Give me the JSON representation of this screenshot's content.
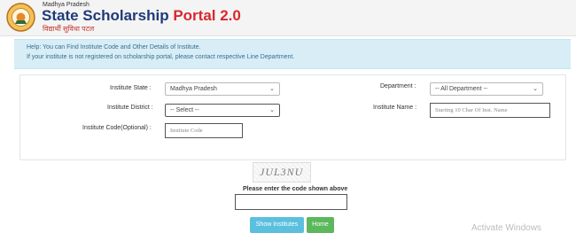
{
  "header": {
    "state": "Madhya Pradesh",
    "title_main": "State Scholarship ",
    "title_accent": "Portal 2.0",
    "hindi": "विद्यार्थी सुविधा पटल"
  },
  "help": {
    "line1": "Help: You can Find Institute Code and Other Details of Institute.",
    "line2": "If your institute is not registered on scholarship portal, please contact respective Line Department."
  },
  "form": {
    "state_label": "Institute State :",
    "state_value": "Madhya Pradesh",
    "district_label": "Institute District :",
    "district_value": "-- Select --",
    "code_label": "Institute Code(Optional) :",
    "code_placeholder": "Institute Code",
    "department_label": "Department :",
    "department_value": "-- All Department --",
    "name_label": "Institute Name :",
    "name_placeholder": "Starting 10 Char Of Inst. Name"
  },
  "captcha": {
    "image_text": "JUL3NU",
    "prompt": "Please enter the code shown above"
  },
  "buttons": {
    "show": "Show Institutes",
    "home": "Home"
  },
  "watermark": "Activate Windows"
}
